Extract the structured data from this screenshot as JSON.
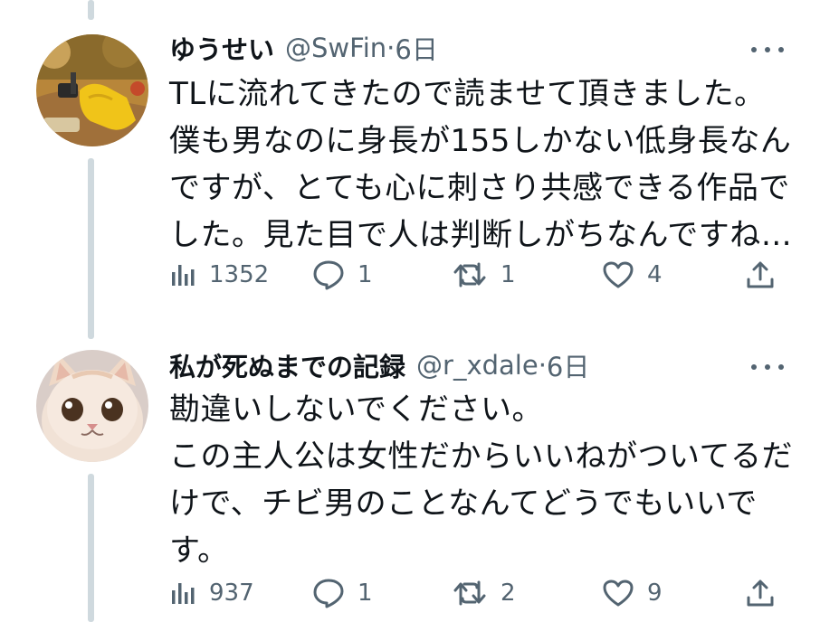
{
  "tweets": [
    {
      "author_name": "ゆうせい",
      "handle": "@SwFin",
      "separator": "·",
      "time": "6日",
      "lines": [
        "TLに流れてきたので読ませて頂きました。",
        "僕も男なのに身長が155しかない低身長なん",
        "ですが、とても心に刺さり共感できる作品で",
        "した。見た目で人は判断しがちなんですね…"
      ],
      "views": "1352",
      "replies": "1",
      "retweets": "1",
      "likes": "4"
    },
    {
      "author_name": "私が死ぬまでの記録",
      "handle": "@r_xdale",
      "separator": "·",
      "time": "6日",
      "lines": [
        "勘違いしないでください。",
        "この主人公は女性だからいいねがついてるだ",
        "けで、チビ男のことなんてどうでもいいで",
        "す。"
      ],
      "views": "937",
      "replies": "1",
      "retweets": "2",
      "likes": "9"
    }
  ],
  "colors": {
    "text": "#0f1419",
    "muted": "#536471",
    "thread_line": "#cfd9de"
  },
  "icons": [
    "views-icon",
    "reply-icon",
    "retweet-icon",
    "like-icon",
    "share-icon",
    "more-icon"
  ]
}
